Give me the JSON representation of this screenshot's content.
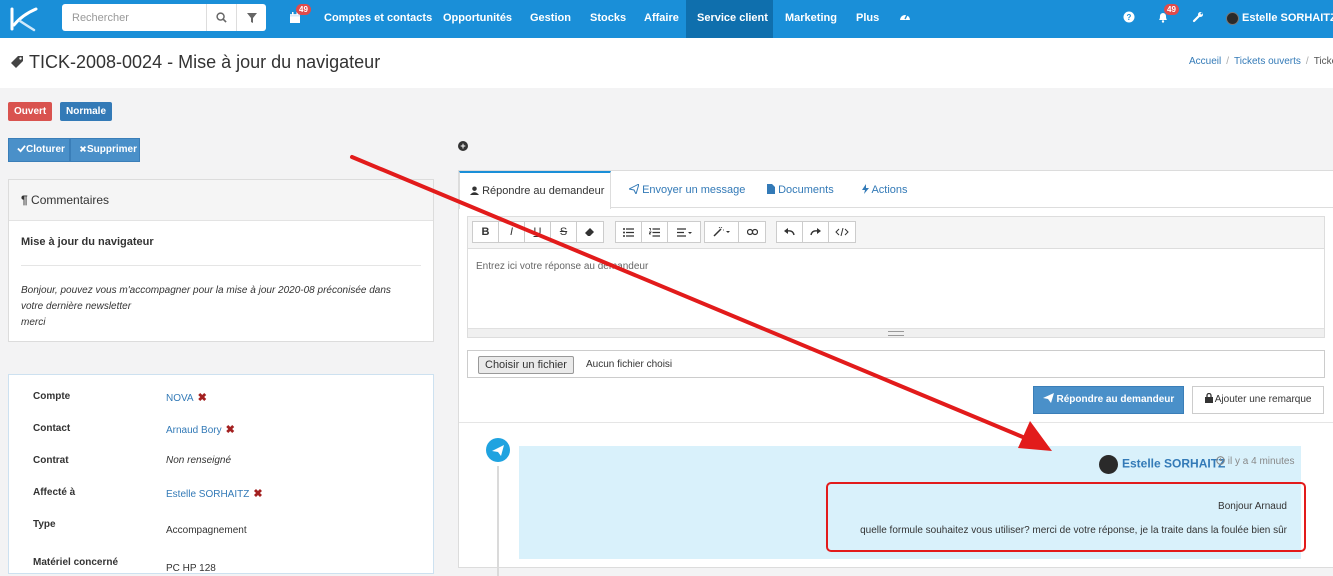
{
  "topbar": {
    "search_placeholder": "Rechercher",
    "calendar_badge": "49",
    "nav": [
      "Comptes et contacts",
      "Opportunités",
      "Gestion",
      "Stocks",
      "Affaire",
      "Service client",
      "Marketing",
      "Plus"
    ],
    "active_nav": "Service client",
    "notif_badge": "49",
    "user_name": "Estelle SORHAITZ",
    "accent_color": "#1a8fd8"
  },
  "page": {
    "title": "TICK-2008-0024 - Mise à jour du navigateur",
    "breadcrumb": [
      "Accueil",
      "Tickets ouverts",
      "Ticket"
    ]
  },
  "status": {
    "state": "Ouvert",
    "priority": "Normale"
  },
  "actions": {
    "close_label": "Cloturer",
    "delete_label": "Supprimer"
  },
  "comments": {
    "heading": "Commentaires",
    "subject": "Mise à jour du navigateur",
    "body_line1": "Bonjour, pouvez vous m'accompagner pour la mise à jour 2020-08 préconisée dans",
    "body_line2": "votre dernière newsletter",
    "body_line3": "merci"
  },
  "info": {
    "rows": [
      {
        "label": "Compte",
        "value": "NOVA"
      },
      {
        "label": "Contact",
        "value": "Arnaud Bory"
      },
      {
        "label": "Contrat",
        "value": "Non renseigné"
      },
      {
        "label": "Affecté à",
        "value": "Estelle SORHAITZ"
      },
      {
        "label": "Type",
        "value": "Accompagnement"
      },
      {
        "label": "Matériel concerné",
        "value": "PC HP 128"
      }
    ]
  },
  "tabs": [
    "Répondre au demandeur",
    "Envoyer un message",
    "Documents",
    "Actions"
  ],
  "editor": {
    "placeholder": "Entrez ici votre réponse au demandeur",
    "toolbar_bold": "B",
    "toolbar_italic": "I",
    "toolbar_underline": "U",
    "toolbar_strike": "S"
  },
  "file": {
    "button_label": "Choisir un fichier",
    "status": "Aucun fichier choisi"
  },
  "reply": {
    "reply_label": "Répondre au demandeur",
    "remark_label": "Ajouter une remarque"
  },
  "message": {
    "author": "Estelle SORHAITZ",
    "time": "il y a 4 minutes",
    "line1": "Bonjour Arnaud",
    "line2": "quelle formule souhaitez vous utiliser? merci de votre réponse, je la traite dans la foulée bien sûr"
  },
  "annotation_color": "#e21b1b"
}
